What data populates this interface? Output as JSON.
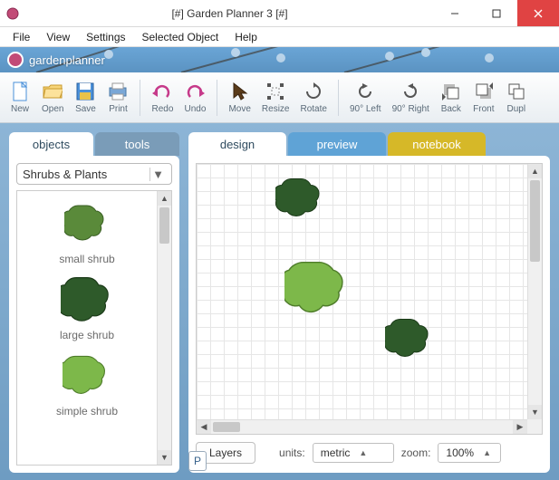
{
  "window": {
    "title": "[#] Garden Planner 3 [#]"
  },
  "menu": {
    "file": "File",
    "view": "View",
    "settings": "Settings",
    "selected_object": "Selected Object",
    "help": "Help"
  },
  "brand": "gardenplanner",
  "toolbar": {
    "new": "New",
    "open": "Open",
    "save": "Save",
    "print": "Print",
    "redo": "Redo",
    "undo": "Undo",
    "move": "Move",
    "resize": "Resize",
    "rotate": "Rotate",
    "left90": "90° Left",
    "right90": "90° Right",
    "back": "Back",
    "front": "Front",
    "dupl": "Dupl"
  },
  "left": {
    "tab_objects": "objects",
    "tab_tools": "tools",
    "category": "Shrubs & Plants",
    "items": [
      {
        "label": "small shrub"
      },
      {
        "label": "large shrub"
      },
      {
        "label": "simple shrub"
      }
    ]
  },
  "p_button": "P",
  "design": {
    "tab_design": "design",
    "tab_preview": "preview",
    "tab_notebook": "notebook",
    "layers": "Layers",
    "units_label": "units:",
    "units_value": "metric",
    "zoom_label": "zoom:",
    "zoom_value": "100%"
  }
}
